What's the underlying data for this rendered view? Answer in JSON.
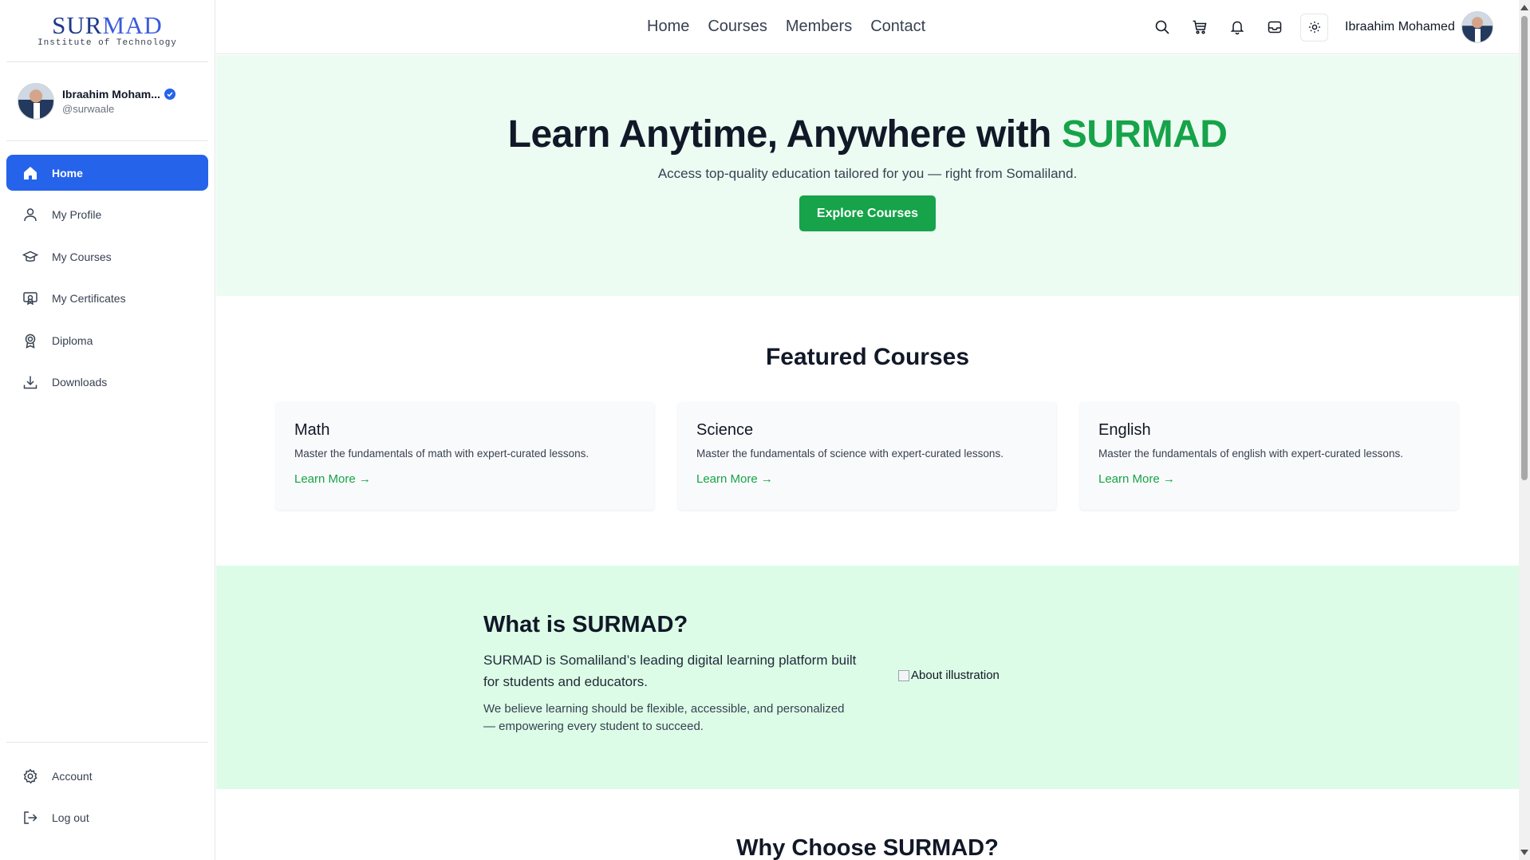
{
  "logo": {
    "part1": "SUR",
    "part2": "MAD",
    "subtitle": "Institute of Technology"
  },
  "user": {
    "name": "Ibraahim Moham...",
    "handle": "@surwaale",
    "full_name": "Ibraahim Mohamed"
  },
  "sidebar": {
    "items": [
      {
        "label": "Home",
        "icon": "home-icon",
        "active": true
      },
      {
        "label": "My Profile",
        "icon": "user-icon",
        "active": false
      },
      {
        "label": "My Courses",
        "icon": "graduation-cap-icon",
        "active": false
      },
      {
        "label": "My Certificates",
        "icon": "certificate-icon",
        "active": false
      },
      {
        "label": "Diploma",
        "icon": "award-icon",
        "active": false
      },
      {
        "label": "Downloads",
        "icon": "download-icon",
        "active": false
      }
    ],
    "bottom": [
      {
        "label": "Account",
        "icon": "gear-icon"
      },
      {
        "label": "Log out",
        "icon": "logout-icon"
      }
    ]
  },
  "header": {
    "nav": [
      "Home",
      "Courses",
      "Members",
      "Contact"
    ],
    "icons": [
      "search-icon",
      "cart-icon",
      "bell-icon",
      "inbox-icon",
      "sun-icon"
    ]
  },
  "hero": {
    "title_prefix": "Learn Anytime, Anywhere with ",
    "title_brand": "SURMAD",
    "subtitle": "Access top-quality education tailored for you — right from Somaliland.",
    "cta": "Explore Courses"
  },
  "featured": {
    "title": "Featured Courses",
    "courses": [
      {
        "title": "Math",
        "desc": "Master the fundamentals of math with expert-curated lessons.",
        "link": "Learn More →"
      },
      {
        "title": "Science",
        "desc": "Master the fundamentals of science with expert-curated lessons.",
        "link": "Learn More →"
      },
      {
        "title": "English",
        "desc": "Master the fundamentals of english with expert-curated lessons.",
        "link": "Learn More →"
      }
    ]
  },
  "about": {
    "title": "What is SURMAD?",
    "lead": "SURMAD is Somaliland’s leading digital learning platform built for students and educators.",
    "body": "We believe learning should be flexible, accessible, and personalized — empowering every student to succeed.",
    "image_alt": "About illustration"
  },
  "why": {
    "title": "Why Choose SURMAD?"
  },
  "colors": {
    "primary": "#2563eb",
    "brand_green": "#16a34a",
    "hero_bg": "#edfcf2",
    "about_bg": "#dcfce7"
  }
}
